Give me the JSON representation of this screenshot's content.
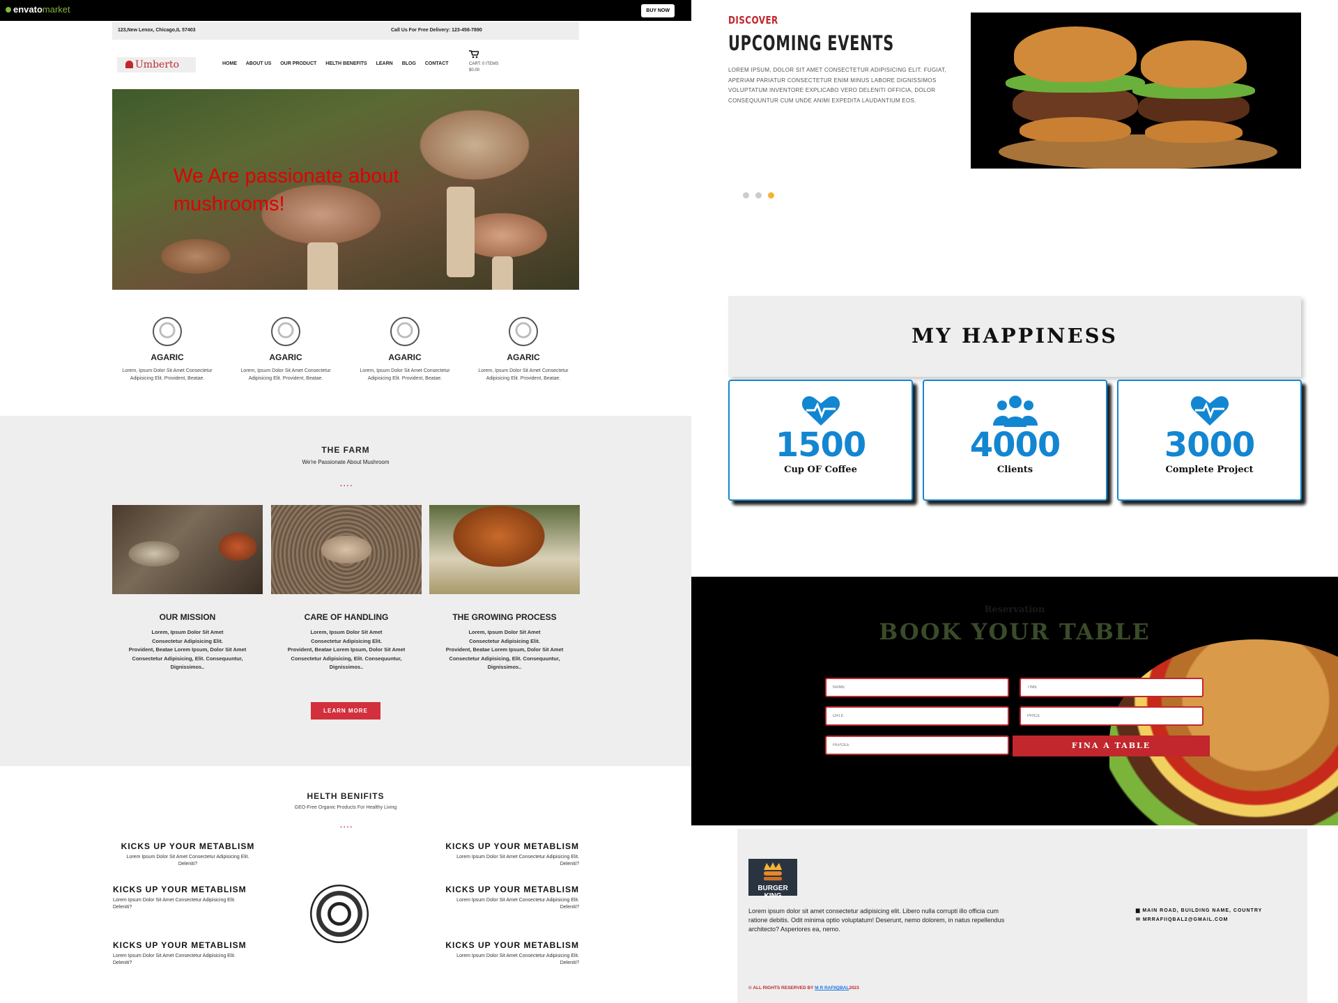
{
  "envato": {
    "logo": "envato",
    "logo_market": "market",
    "buy_now": "BUY NOW"
  },
  "topbar": {
    "address": "123,New Lenox, Chicago,IL 57403",
    "call": "Call Us For Free Delivery: 123-456-7890"
  },
  "brand": {
    "name": "Umberto"
  },
  "nav": [
    "HOME",
    "ABOUT US",
    "OUR PRODUCT",
    "HELTH BENEFITS",
    "LEARN",
    "BLOG",
    "CONTACT"
  ],
  "cart": {
    "label": "CART: 0 ITEMS",
    "total": "$0.00"
  },
  "hero": {
    "line1": "We Are passionate about",
    "line2": "mushrooms!"
  },
  "features": [
    {
      "title": "AGARIC",
      "desc1": "Lorem, Ipsum Dolor Sit Amet Consectetur",
      "desc2": "Adipisicing Elit. Provident, Beatae."
    },
    {
      "title": "AGARIC",
      "desc1": "Lorem, Ipsum Dolor Sit Amet Consectetur",
      "desc2": "Adipisicing Elit. Provident, Beatae."
    },
    {
      "title": "AGARIC",
      "desc1": "Lorem, Ipsum Dolor Sit Amet Consectetur",
      "desc2": "Adipisicing Elit. Provident, Beatae."
    },
    {
      "title": "AGARIC",
      "desc1": "Lorem, Ipsum Dolor Sit Amet Consectetur",
      "desc2": "Adipisicing Elit. Provident, Beatae."
    }
  ],
  "farm": {
    "title": "THE FARM",
    "subtitle": "We're Passionate About Mushroom",
    "dots": "....",
    "columns": [
      {
        "title": "OUR MISSION",
        "l1": "Lorem, Ipsum Dolor Sit Amet",
        "l2": "Consectetur Adipisicing Elit.",
        "l3": "Provident, Beatae Lorem Ipsum, Dolor Sit Amet",
        "l4": "Consectetur Adipisicing, Elit. Consequuntur,",
        "l5": "Dignissimos.."
      },
      {
        "title": "CARE OF HANDLING",
        "l1": "Lorem, Ipsum Dolor Sit Amet",
        "l2": "Consectetur Adipisicing Elit.",
        "l3": "Provident, Beatae Lorem Ipsum, Dolor Sit Amet",
        "l4": "Consectetur Adipisicing, Elit. Consequuntur,",
        "l5": "Dignissimos.."
      },
      {
        "title": "THE GROWING PROCESS",
        "l1": "Lorem, Ipsum Dolor Sit Amet",
        "l2": "Consectetur Adipisicing Elit.",
        "l3": "Provident, Beatae Lorem Ipsum, Dolor Sit Amet",
        "l4": "Consectetur Adipisicing, Elit. Consequuntur,",
        "l5": "Dignissimos.."
      }
    ],
    "learn_more": "LEARN MORE"
  },
  "health": {
    "title": "HELTH BENIFITS",
    "subtitle": "GEO-Free Organic Products For Healthy Living",
    "dots": "....",
    "items": [
      {
        "title": "KICKS UP YOUR METABLISM",
        "d1": "Lorem Ipsum Dolor Sit Amet Consectetur Adipisicing Elit.",
        "d2": "Deleniti?"
      },
      {
        "title": "KICKS UP YOUR METABLISM",
        "d1": "Lorem Ipsum Dolor Sit Amet Consectetur Adipisicing Elit.",
        "d2": "Deleniti?"
      },
      {
        "title": "KICKS UP YOUR METABLISM",
        "d1": "Lorem Ipsum Dolor Sit Amet Consectetur Adipisicing Elit.",
        "d2": "Deleniti?"
      },
      {
        "title": "KICKS UP YOUR METABLISM",
        "d1": "Lorem Ipsum Dolor Sit Amet Consectetur Adipisicing Elit.",
        "d2": "Deleniti?"
      },
      {
        "title": "KICKS UP YOUR METABLISM",
        "d1": "Lorem Ipsum Dolor Sit Amet Consectetur Adipisicing Elit.",
        "d2": "Deleniti?"
      },
      {
        "title": "KICKS UP YOUR METABLISM",
        "d1": "Lorem Ipsum Dolor Sit Amet Consectetur Adipisicing Elit.",
        "d2": "Deleniti?"
      }
    ]
  },
  "events": {
    "kicker": "DISCOVER",
    "title": "UPCOMING EVENTS",
    "text": "LOREM IPSUM, DOLOR SIT AMET CONSECTETUR ADIPISICING ELIT. FUGIAT, APERIAM PARIATUR CONSECTETUR ENIM MINUS LABORE DIGNISSIMOS VOLUPTATUM INVENTORE EXPLICABO VERO DELENITI OFFICIA, DOLOR CONSEQUUNTUR CUM UNDE ANIMI EXPEDITA LAUDANTIUM EOS."
  },
  "happiness": {
    "title": "MY HAPPINESS",
    "stats": [
      {
        "icon": "heartbeat-icon",
        "number": "1500",
        "label": "Cup OF Coffee"
      },
      {
        "icon": "users-icon",
        "number": "4000",
        "label": "Clients"
      },
      {
        "icon": "heartbeat-icon",
        "number": "3000",
        "label": "Complete Project"
      }
    ]
  },
  "booking": {
    "kicker": "Reservation",
    "title": "BOOK YOUR TABLE",
    "fields": {
      "name": "NAME",
      "time": "TIME",
      "date": "DATE",
      "price": "PRICE",
      "people": "PEPOLE"
    },
    "submit": "FINA A TABLE"
  },
  "footer": {
    "brand": "BURGER KING",
    "text": "Lorem ipsum dolor sit amet consectetur adipisicing elit. Libero nulla corrupti illo officia cum ratione debitis. Odit minima optio voluptatum! Deserunt, nemo dolorem, in natus repellendus architecto? Asperiores ea, nemo.",
    "address": "MAIN ROAD, BUILDING NAME, COUNTRY",
    "email": "MRRAFIIQBAL2@GMAIL.COM",
    "copy_prefix": "© ALL RIGHTS RESERVED BY ",
    "copy_name": "M R RAFIIQBAL",
    "copy_year": "2023"
  },
  "colors": {
    "accent_red": "#c1272d",
    "stat_blue": "#1386d1",
    "hero_text": "#e00000",
    "book_title": "#3a4b2a",
    "active_dot": "#f5b335"
  }
}
